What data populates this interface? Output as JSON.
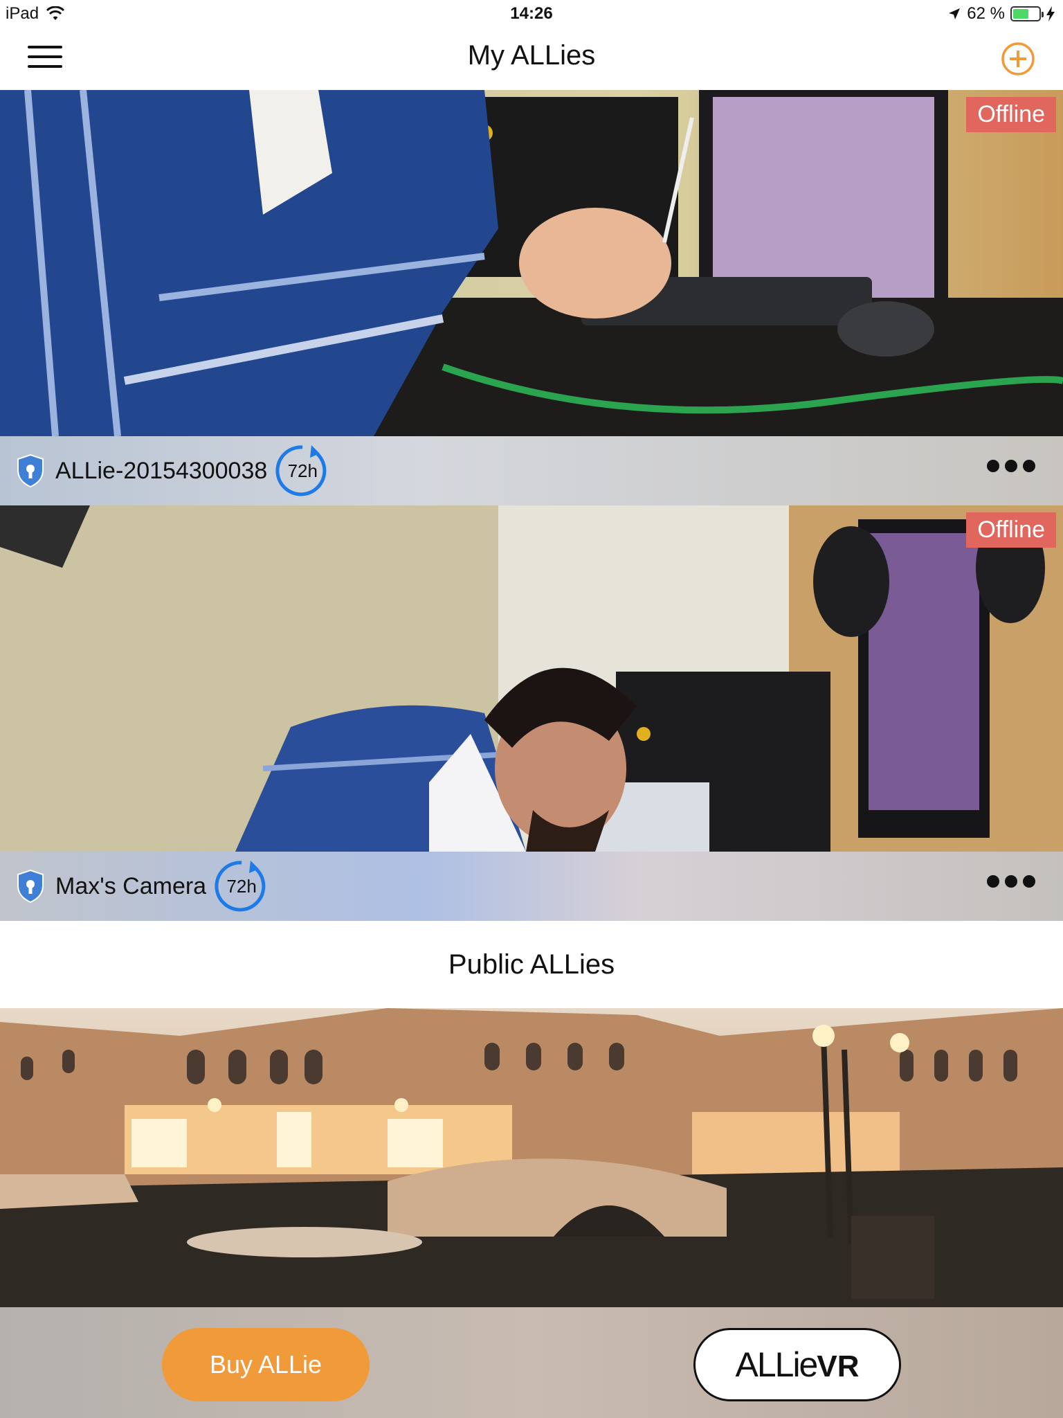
{
  "status_bar": {
    "device": "iPad",
    "time": "14:26",
    "battery_text": "62 %",
    "battery_level": 0.62
  },
  "navbar": {
    "title": "My ALLies",
    "menu_icon": "hamburger-icon",
    "add_icon": "plus-circle-icon",
    "accent_color": "#f19a3a"
  },
  "my_allies": [
    {
      "name": "ALLie-20154300038",
      "status": "Offline",
      "cloud_badge": "72h",
      "shield_icon": "shield-lock-icon",
      "more_icon": "more-dots-icon"
    },
    {
      "name": "Max's Camera",
      "status": "Offline",
      "cloud_badge": "72h",
      "shield_icon": "shield-lock-icon",
      "more_icon": "more-dots-icon"
    }
  ],
  "public_section": {
    "title": "Public ALLies"
  },
  "bottom_bar": {
    "buy_label": "Buy  ALLie",
    "vr_logo_text": "ALLie",
    "vr_logo_suffix": "VR"
  },
  "colors": {
    "offline_badge": "#e0665e",
    "cloud_ring": "#1e7ae6",
    "shield": "#3f7fd6"
  }
}
